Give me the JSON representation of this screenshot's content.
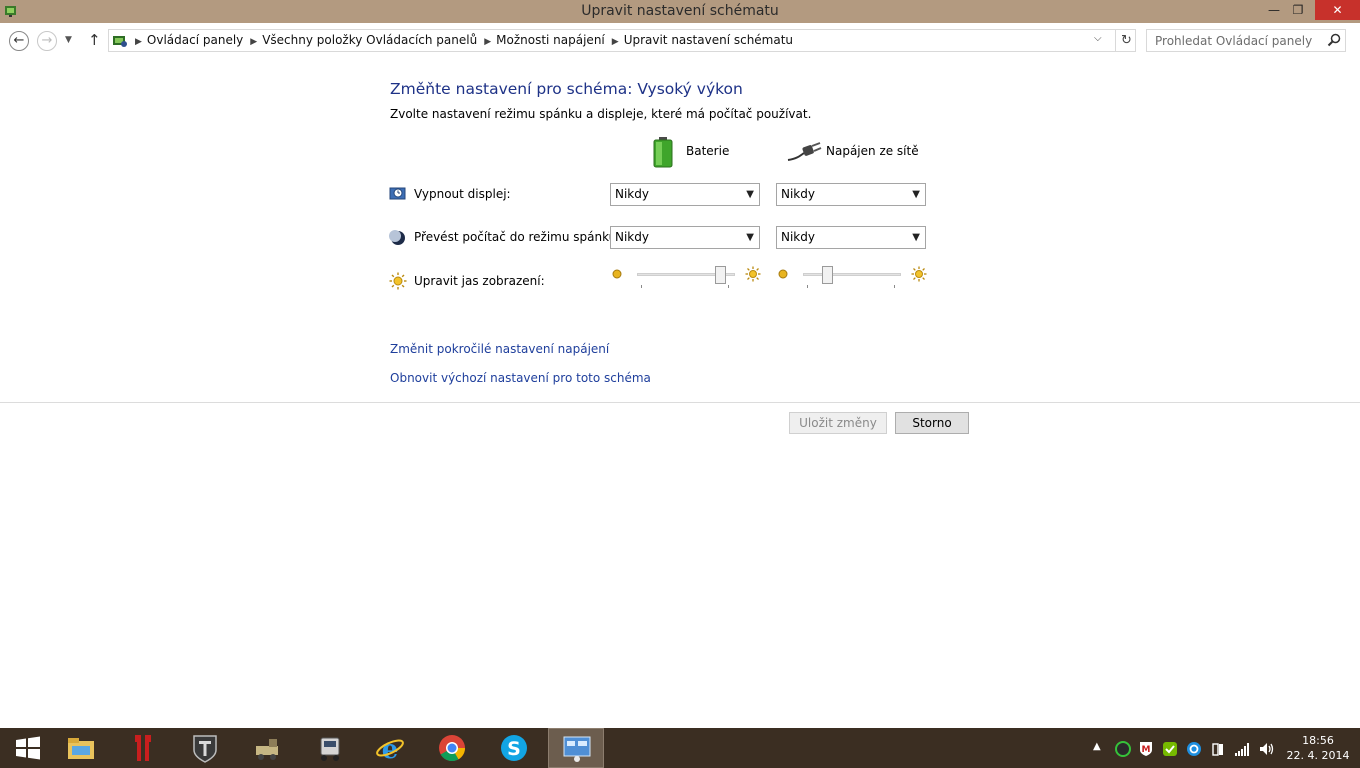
{
  "window": {
    "title": "Upravit nastavení schématu",
    "min_glyph": "—",
    "max_glyph": "❐",
    "close_glyph": "✕"
  },
  "address_bar": {
    "breadcrumbs": [
      "Ovládací panely",
      "Všechny položky Ovládacích panelů",
      "Možnosti napájení",
      "Upravit nastavení schématu"
    ]
  },
  "search": {
    "placeholder": "Prohledat Ovládací panely"
  },
  "main": {
    "heading": "Změňte nastavení pro schéma: Vysoký výkon",
    "subheading": "Zvolte nastavení režimu spánku a displeje, které má počítač používat.",
    "columns": {
      "battery": "Baterie",
      "plugged_in": "Napájen ze sítě"
    },
    "rows": {
      "display_off": {
        "label": "Vypnout displej:",
        "battery_value": "Nikdy",
        "plugged_value": "Nikdy"
      },
      "sleep": {
        "label": "Převést počítač do režimu spánku:",
        "battery_value": "Nikdy",
        "plugged_value": "Nikdy"
      },
      "brightness": {
        "label": "Upravit jas zobrazení:",
        "battery_level": 0.9,
        "plugged_level": 0.22
      }
    },
    "links": {
      "advanced": "Změnit pokročilé nastavení napájení",
      "restore": "Obnovit výchozí nastavení pro toto schéma"
    },
    "buttons": {
      "save": "Uložit změny",
      "cancel": "Storno"
    }
  },
  "taskbar": {
    "items": [
      "start-button",
      "file-explorer",
      "game-app",
      "world-of-tanks",
      "steam-app",
      "truck-simulator",
      "internet-explorer",
      "chrome",
      "skype",
      "control-panel"
    ],
    "clock": {
      "time": "18:56",
      "date": "22. 4. 2014"
    }
  },
  "colors": {
    "titlebar": "#b39a80",
    "taskbar": "#3b2e22",
    "heading": "#1e3287",
    "link": "#1f3f9c",
    "close": "#c7312b"
  }
}
